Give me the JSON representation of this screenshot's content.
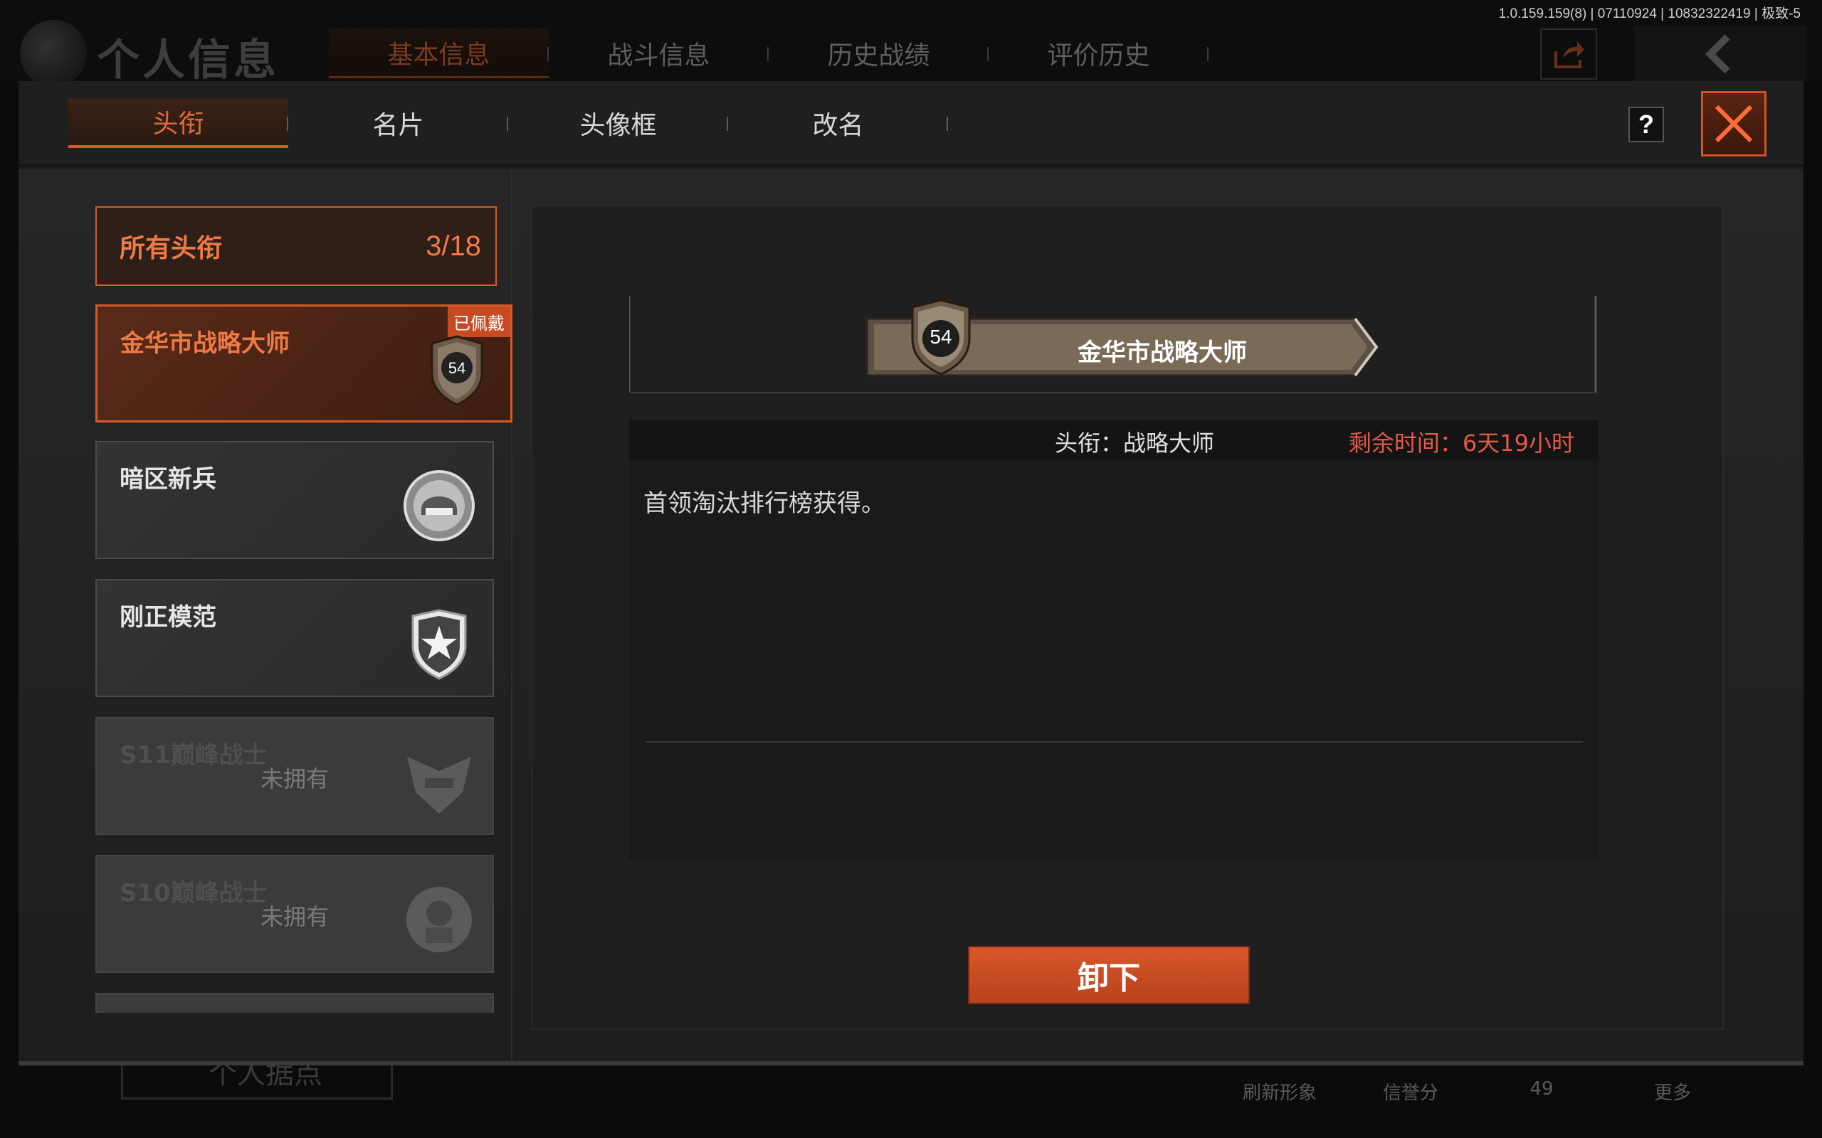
{
  "version": "1.0.159.159(8) | 07110924 | 10832322419 | 极致-5",
  "page": {
    "title": "个人信息",
    "tabs": [
      "基本信息",
      "战斗信息",
      "历史战绩",
      "评价历史"
    ]
  },
  "bottom_bar": {
    "base_label": "个人据点",
    "items": [
      "刷新形象",
      "信誉分",
      "49",
      "更多"
    ]
  },
  "modal": {
    "tabs": [
      "头衔",
      "名片",
      "头像框",
      "改名"
    ],
    "help": "?",
    "all_titles": {
      "label": "所有头衔",
      "count": "3/18"
    },
    "titles": [
      {
        "name": "金华市战略大师",
        "level": "54",
        "tag": "已佩戴",
        "state": "selected"
      },
      {
        "name": "暗区新兵",
        "state": "owned"
      },
      {
        "name": "刚正模范",
        "state": "owned"
      },
      {
        "name": "S11巅峰战士",
        "status": "未拥有",
        "state": "locked"
      },
      {
        "name": "S10巅峰战士",
        "status": "未拥有",
        "state": "locked"
      }
    ],
    "detail": {
      "banner_level": "54",
      "banner_name": "金华市战略大师",
      "title_label": "头衔：战略大师",
      "time_remaining": "剩余时间：6天19小时",
      "description": "首领淘汰排行榜获得。"
    },
    "unequip_label": "卸下"
  },
  "colors": {
    "accent": "#d45a2a",
    "accent_text": "#f07a45",
    "warning": "#e05a4a"
  }
}
